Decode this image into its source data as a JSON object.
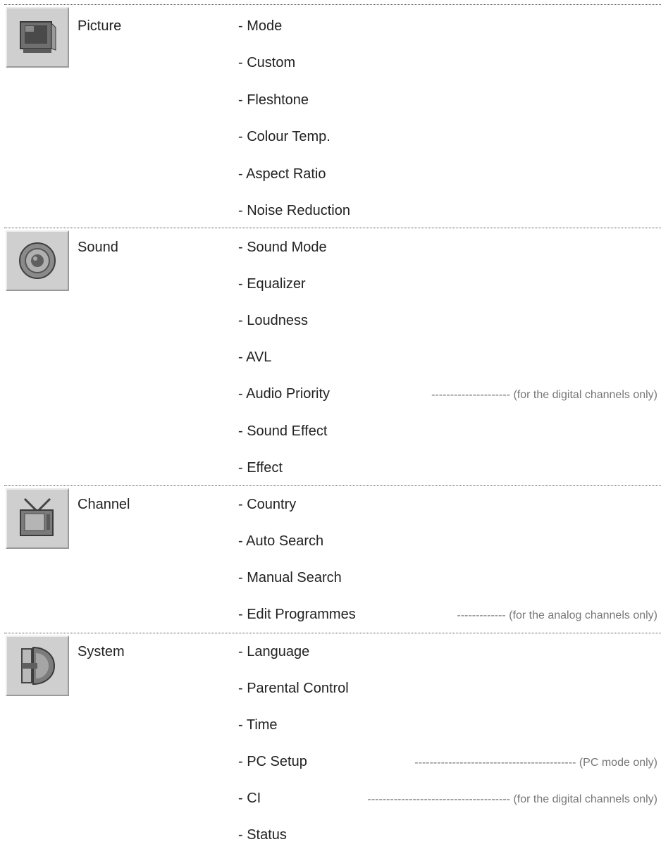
{
  "sections": [
    {
      "category": "Picture",
      "icon": "tv-monitor-icon",
      "items": [
        {
          "label": "- Mode"
        },
        {
          "label": "- Custom"
        },
        {
          "label": "- Fleshtone"
        },
        {
          "label": "- Colour Temp."
        },
        {
          "label": "- Aspect Ratio"
        },
        {
          "label": "- Noise Reduction"
        }
      ]
    },
    {
      "category": "Sound",
      "icon": "speaker-icon",
      "items": [
        {
          "label": "- Sound Mode"
        },
        {
          "label": "- Equalizer"
        },
        {
          "label": "- Loudness"
        },
        {
          "label": "- AVL"
        },
        {
          "label": "- Audio Priority",
          "dashes": "---------------------",
          "note": "(for the digital channels only)"
        },
        {
          "label": "- Sound Effect"
        },
        {
          "label": "- Effect"
        }
      ]
    },
    {
      "category": "Channel",
      "icon": "tv-antenna-icon",
      "items": [
        {
          "label": "- Country"
        },
        {
          "label": "- Auto Search"
        },
        {
          "label": "- Manual Search"
        },
        {
          "label": "- Edit Programmes",
          "dashes": "-------------",
          "note": "(for the analog channels only)"
        }
      ]
    },
    {
      "category": "System",
      "icon": "system-settings-icon",
      "items": [
        {
          "label": "- Language"
        },
        {
          "label": "- Parental Control"
        },
        {
          "label": "- Time"
        },
        {
          "label": "- PC Setup",
          "dashes": "-------------------------------------------",
          "note": "(PC mode only)"
        },
        {
          "label": "- CI",
          "dashes": "--------------------------------------",
          "note": "(for the digital channels only)"
        },
        {
          "label": "- Status"
        }
      ]
    }
  ]
}
